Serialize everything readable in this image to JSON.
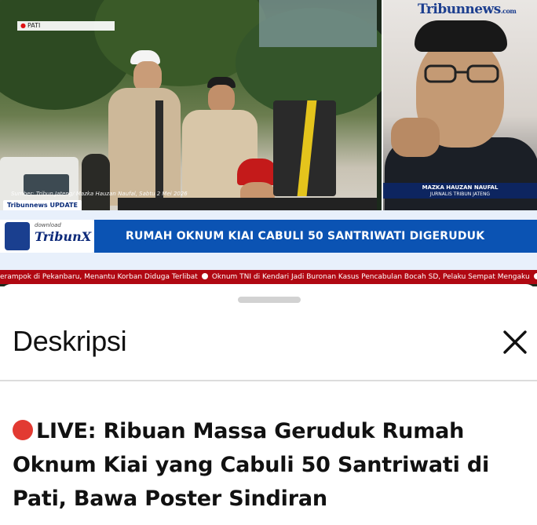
{
  "video": {
    "location_tag": "PATI",
    "source_caption": "Sumber: Tribun Jateng/ Mazka Hauzan Naufal, Sabtu 2 Mei 2026",
    "brand_update": "Tribunnews UPDATE",
    "inset": {
      "logo": "Tribunnews",
      "logo_suffix": ".com",
      "reporter_name": "MAZKA HAUZAN NAUFAL",
      "reporter_role": "JURNALIS TRIBUN JATENG"
    },
    "promo": {
      "download_label": "download",
      "brand": "TribunX"
    },
    "headline": "RUMAH OKNUM KIAI CABULI 50 SANTRIWATI DIGERUDUK",
    "ticker": {
      "item1": "erampok di Pekanbaru, Menantu Korban Diduga Terlibat",
      "item2": "Oknum TNI di Kendari Jadi Buronan Kasus Pencabulan Bocah SD, Pelaku Sempat Mengaku"
    },
    "colors": {
      "headline_bg": "#0b53b3",
      "ticker_bg": "#b00812",
      "brand_navy": "#0d2a7a"
    }
  },
  "sheet": {
    "title": "Deskripsi",
    "close_icon": "close-icon",
    "description_title": "LIVE: Ribuan Massa Geruduk Rumah Oknum Kiai yang Cabuli 50 Santriwati di Pati, Bawa Poster Sindiran",
    "live_icon": "red-circle-icon",
    "colors": {
      "live_dot": "#e23a32",
      "text": "#111111"
    }
  }
}
